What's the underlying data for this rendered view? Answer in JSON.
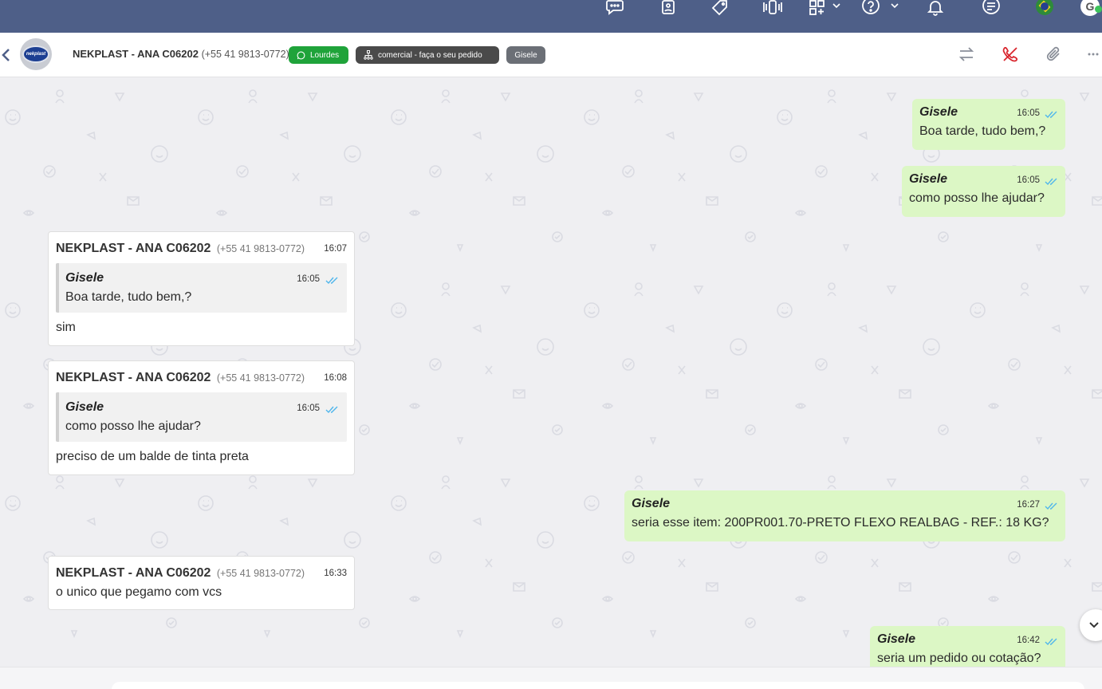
{
  "topbar": {
    "icons": [
      "chat-icon",
      "contacts-icon",
      "tag-icon",
      "phone-icon",
      "apps-icon",
      "help-icon",
      "bell-icon",
      "list-icon"
    ],
    "flag": "brazil-flag",
    "user_initial": "G"
  },
  "header": {
    "contact_name": "NEKPLAST - ANA C06202",
    "contact_phone": "(+55 41 9813-0772)",
    "avatar_text": "nekplast",
    "tags": [
      {
        "label": "Lourdes",
        "color": "#1fa33a"
      },
      {
        "label": "comercial - faça o seu pedido",
        "color": "#4a4a4a"
      },
      {
        "label": "Gisele",
        "color": "#6b6f76"
      }
    ]
  },
  "messages": [
    {
      "dir": "out",
      "author": "Gisele",
      "time": "16:05",
      "text": "Boa tarde, tudo bem,?"
    },
    {
      "dir": "out",
      "author": "Gisele",
      "time": "16:05",
      "text": "como posso lhe ajudar?"
    },
    {
      "dir": "in",
      "author": "NEKPLAST - ANA C06202",
      "phone": "(+55 41 9813-0772)",
      "time": "16:07",
      "quote": {
        "author": "Gisele",
        "time": "16:05",
        "text": "Boa tarde, tudo bem,?"
      },
      "text": "sim"
    },
    {
      "dir": "in",
      "author": "NEKPLAST - ANA C06202",
      "phone": "(+55 41 9813-0772)",
      "time": "16:08",
      "quote": {
        "author": "Gisele",
        "time": "16:05",
        "text": "como posso lhe ajudar?"
      },
      "text": "preciso de um balde de tinta preta"
    },
    {
      "dir": "out",
      "author": "Gisele",
      "time": "16:27",
      "text": "seria esse item: 200PR001.70-PRETO FLEXO REALBAG - REF.: 18 KG?"
    },
    {
      "dir": "in",
      "author": "NEKPLAST - ANA C06202",
      "phone": "(+55 41 9813-0772)",
      "time": "16:33",
      "text": "o unico que pegamo com vcs"
    },
    {
      "dir": "out",
      "author": "Gisele",
      "time": "16:42",
      "text": "seria um pedido ou cotação?"
    }
  ],
  "colors": {
    "topbar": "#4e5f88",
    "outgoing": "#dcf7c5",
    "ticks": "#4fb6ec",
    "end_call": "#d9262e"
  }
}
